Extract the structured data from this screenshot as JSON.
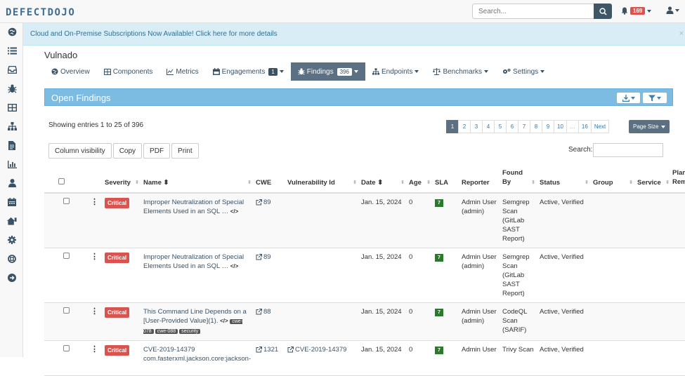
{
  "header": {
    "search_placeholder": "Search...",
    "alert_count": "169"
  },
  "sidebar": {
    "icons": [
      "dashboard-icon",
      "list-icon",
      "inbox-icon",
      "bug-icon",
      "table-icon",
      "sitemap-icon",
      "file-icon",
      "chart-icon",
      "user-icon",
      "calendar-icon",
      "home-icon",
      "gear-icon",
      "lifesaver-icon",
      "arrow-circle-icon"
    ]
  },
  "announcement": "Cloud and On-Premise Subscriptions Now Available! Click here for more details",
  "product": {
    "title": "Vulnado",
    "tabs": [
      {
        "label": "Overview",
        "icon": "globe-icon"
      },
      {
        "label": "Components",
        "icon": "table-icon"
      },
      {
        "label": "Metrics",
        "icon": "chart-icon"
      },
      {
        "label": "Engagements",
        "icon": "calendar-icon",
        "badge": "1"
      },
      {
        "label": "Findings",
        "icon": "bug-icon",
        "badge": "396"
      },
      {
        "label": "Endpoints",
        "icon": "sitemap-icon"
      },
      {
        "label": "Benchmarks",
        "icon": "balance-icon"
      },
      {
        "label": "Settings",
        "icon": "gears-icon"
      }
    ]
  },
  "panel": {
    "title": "Open Findings",
    "entries_info": "Showing entries 1 to 25 of 396",
    "pages": [
      "1",
      "2",
      "3",
      "4",
      "5",
      "6",
      "7",
      "8",
      "9",
      "10",
      "…",
      "16",
      "Next"
    ],
    "page_size_label": "Page Size",
    "buttons": [
      "Column visibility",
      "Copy",
      "PDF",
      "Print"
    ],
    "search_label": "Search:"
  },
  "table": {
    "headers": {
      "severity": "Severity",
      "name": "Name",
      "cwe": "CWE",
      "vuln_id": "Vulnerability Id",
      "date": "Date",
      "age": "Age",
      "sla": "SLA",
      "reporter": "Reporter",
      "found_by": "Found By",
      "status": "Status",
      "group": "Group",
      "service": "Service",
      "planned": "Planned Remediation"
    },
    "rows": [
      {
        "severity": "Critical",
        "name": "Improper Neutralization of Special Elements Used in an SQL …",
        "tags": [],
        "cwe": "89",
        "vuln_id": "",
        "date": "Jan. 15, 2024",
        "age": "0",
        "sla": "7",
        "reporter": "Admin User (admin)",
        "found_by": "Semgrep Scan (GitLab SAST Report)",
        "status": "Active, Verified"
      },
      {
        "severity": "Critical",
        "name": "Improper Neutralization of Special Elements Used in an SQL …",
        "tags": [],
        "cwe": "89",
        "vuln_id": "",
        "date": "Jan. 15, 2024",
        "age": "0",
        "sla": "7",
        "reporter": "Admin User (admin)",
        "found_by": "Semgrep Scan (GitLab SAST Report)",
        "status": "Active, Verified"
      },
      {
        "severity": "Critical",
        "name": "This Command Line Depends on a [User-Provided Value](1).",
        "tags": [
          "cwe-078",
          "cwe-088",
          "security"
        ],
        "cwe": "88",
        "vuln_id": "",
        "date": "Jan. 15, 2024",
        "age": "0",
        "sla": "7",
        "reporter": "Admin User (admin)",
        "found_by": "CodeQL Scan (SARIF)",
        "status": "Active, Verified"
      },
      {
        "severity": "Critical",
        "name": "CVE-2019-14379 com.fasterxml.jackson.core:jackson-",
        "tags": [],
        "cwe": "1321",
        "vuln_id": "CVE-2019-14379",
        "date": "Jan. 15, 2024",
        "age": "0",
        "sla": "7",
        "reporter": "Admin User",
        "found_by": "Trivy Scan",
        "status": "Active, Verified"
      }
    ]
  }
}
